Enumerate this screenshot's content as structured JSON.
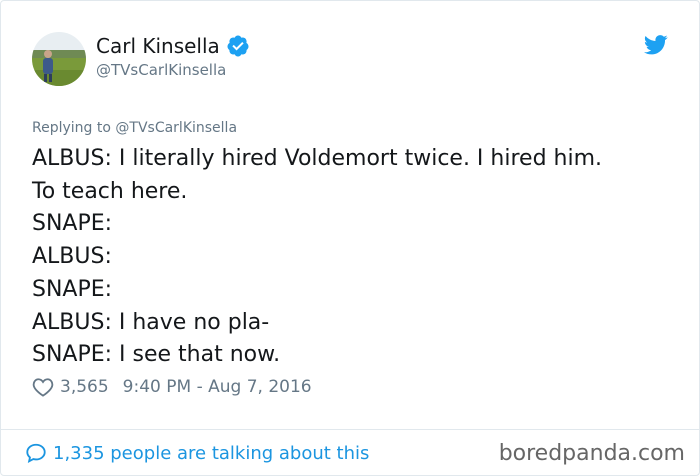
{
  "author": {
    "name": "Carl Kinsella",
    "handle": "@TVsCarlKinsella",
    "verified_icon": "verified-badge-icon",
    "platform_icon": "twitter-bird-icon"
  },
  "reply": {
    "prefix": "Replying to ",
    "target": "@TVsCarlKinsella"
  },
  "tweet": {
    "lines": [
      "ALBUS: I literally hired Voldemort twice. I hired him.",
      "To teach here.",
      "SNAPE:",
      "ALBUS:",
      "SNAPE:",
      "ALBUS: I have no pla-",
      "SNAPE: I see that now."
    ]
  },
  "meta": {
    "likes": "3,565",
    "timestamp": "9:40 PM - Aug 7, 2016"
  },
  "footer": {
    "talking": "1,335 people are talking about this",
    "watermark": "boredpanda.com"
  },
  "colors": {
    "accent": "#1da1f2",
    "link": "#1b95e0",
    "muted": "#657786",
    "text": "#14171a"
  }
}
